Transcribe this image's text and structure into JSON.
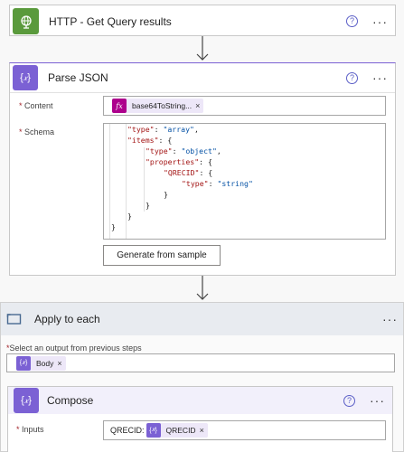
{
  "http": {
    "title": "HTTP - Get Query results",
    "color": "#5a9a3c"
  },
  "parse": {
    "title": "Parse JSON",
    "color": "#7b61d4",
    "content_label": "Content",
    "content_token": "base64ToString...",
    "schema_label": "Schema",
    "schema_lines": [
      "\"type\": \"array\",",
      "\"items\": {",
      "\"type\": \"object\",",
      "\"properties\": {",
      "\"QRECID\": {",
      "\"type\": \"string\"",
      "}",
      "}",
      "}",
      "}"
    ],
    "generate_label": "Generate from sample"
  },
  "apply": {
    "title": "Apply to each",
    "color": "#486991",
    "select_label": "Select an output from previous steps",
    "token": "Body"
  },
  "compose": {
    "title": "Compose",
    "color": "#7b61d4",
    "inputs_label": "Inputs",
    "prefix": "QRECID:",
    "token": "QRECID"
  },
  "glyphs": {
    "help": "?",
    "more": "···",
    "remove": "×",
    "required": "*",
    "fx": "fx"
  }
}
